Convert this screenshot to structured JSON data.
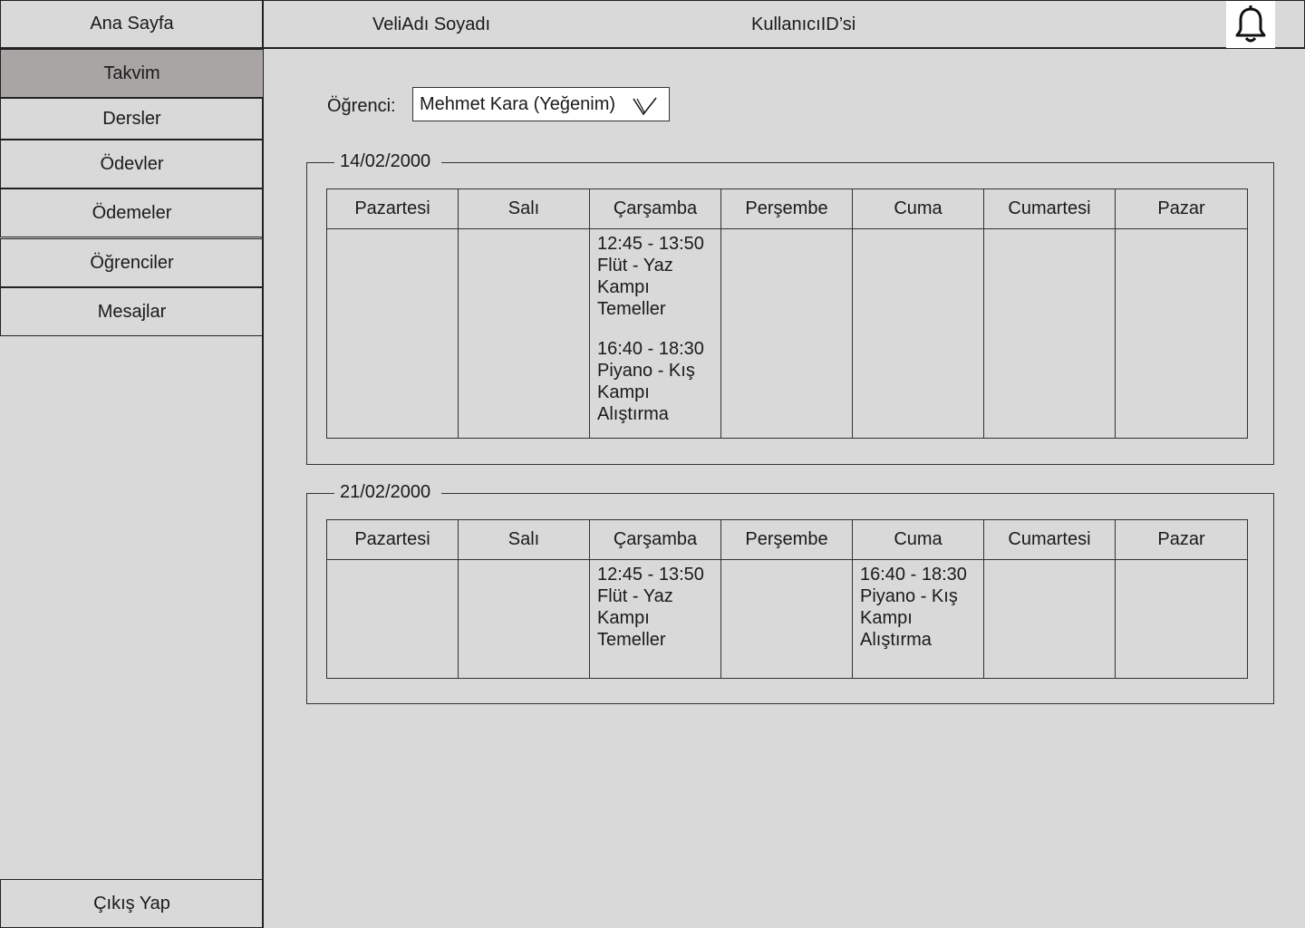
{
  "sidebar": {
    "home": "Ana Sayfa",
    "items": [
      {
        "label": "Takvim",
        "active": true
      },
      {
        "label": "Dersler",
        "active": false
      },
      {
        "label": "Ödevler",
        "active": false
      },
      {
        "label": "Ödemeler",
        "active": false
      },
      {
        "label": "Öğrenciler",
        "active": false
      },
      {
        "label": "Mesajlar",
        "active": false
      }
    ],
    "logout": "Çıkış Yap"
  },
  "header": {
    "user_name": "VeliAdı Soyadı",
    "user_id": "KullanıcıID’si",
    "notification_icon": "bell-icon"
  },
  "student": {
    "label": "Öğrenci:",
    "selected": "Mehmet Kara (Yeğenim)"
  },
  "days": [
    "Pazartesi",
    "Salı",
    "Çarşamba",
    "Perşembe",
    "Cuma",
    "Cumartesi",
    "Pazar"
  ],
  "weeks": [
    {
      "date": "14/02/2000",
      "events": [
        [],
        [],
        [
          {
            "time": "12:45 - 13:50",
            "lines": [
              "Flüt - Yaz",
              "Kampı",
              "Temeller"
            ]
          },
          {
            "time": "16:40 - 18:30",
            "lines": [
              "Piyano  - Kış",
              "Kampı",
              "Alıştırma"
            ]
          }
        ],
        [],
        [],
        [],
        []
      ]
    },
    {
      "date": "21/02/2000",
      "events": [
        [],
        [],
        [
          {
            "time": "12:45 - 13:50",
            "lines": [
              "Flüt - Yaz",
              "Kampı",
              "Temeller"
            ]
          }
        ],
        [],
        [
          {
            "time": "16:40 - 18:30",
            "lines": [
              "Piyano  - Kış",
              "Kampı",
              "Alıştırma"
            ]
          }
        ],
        [],
        []
      ]
    }
  ]
}
